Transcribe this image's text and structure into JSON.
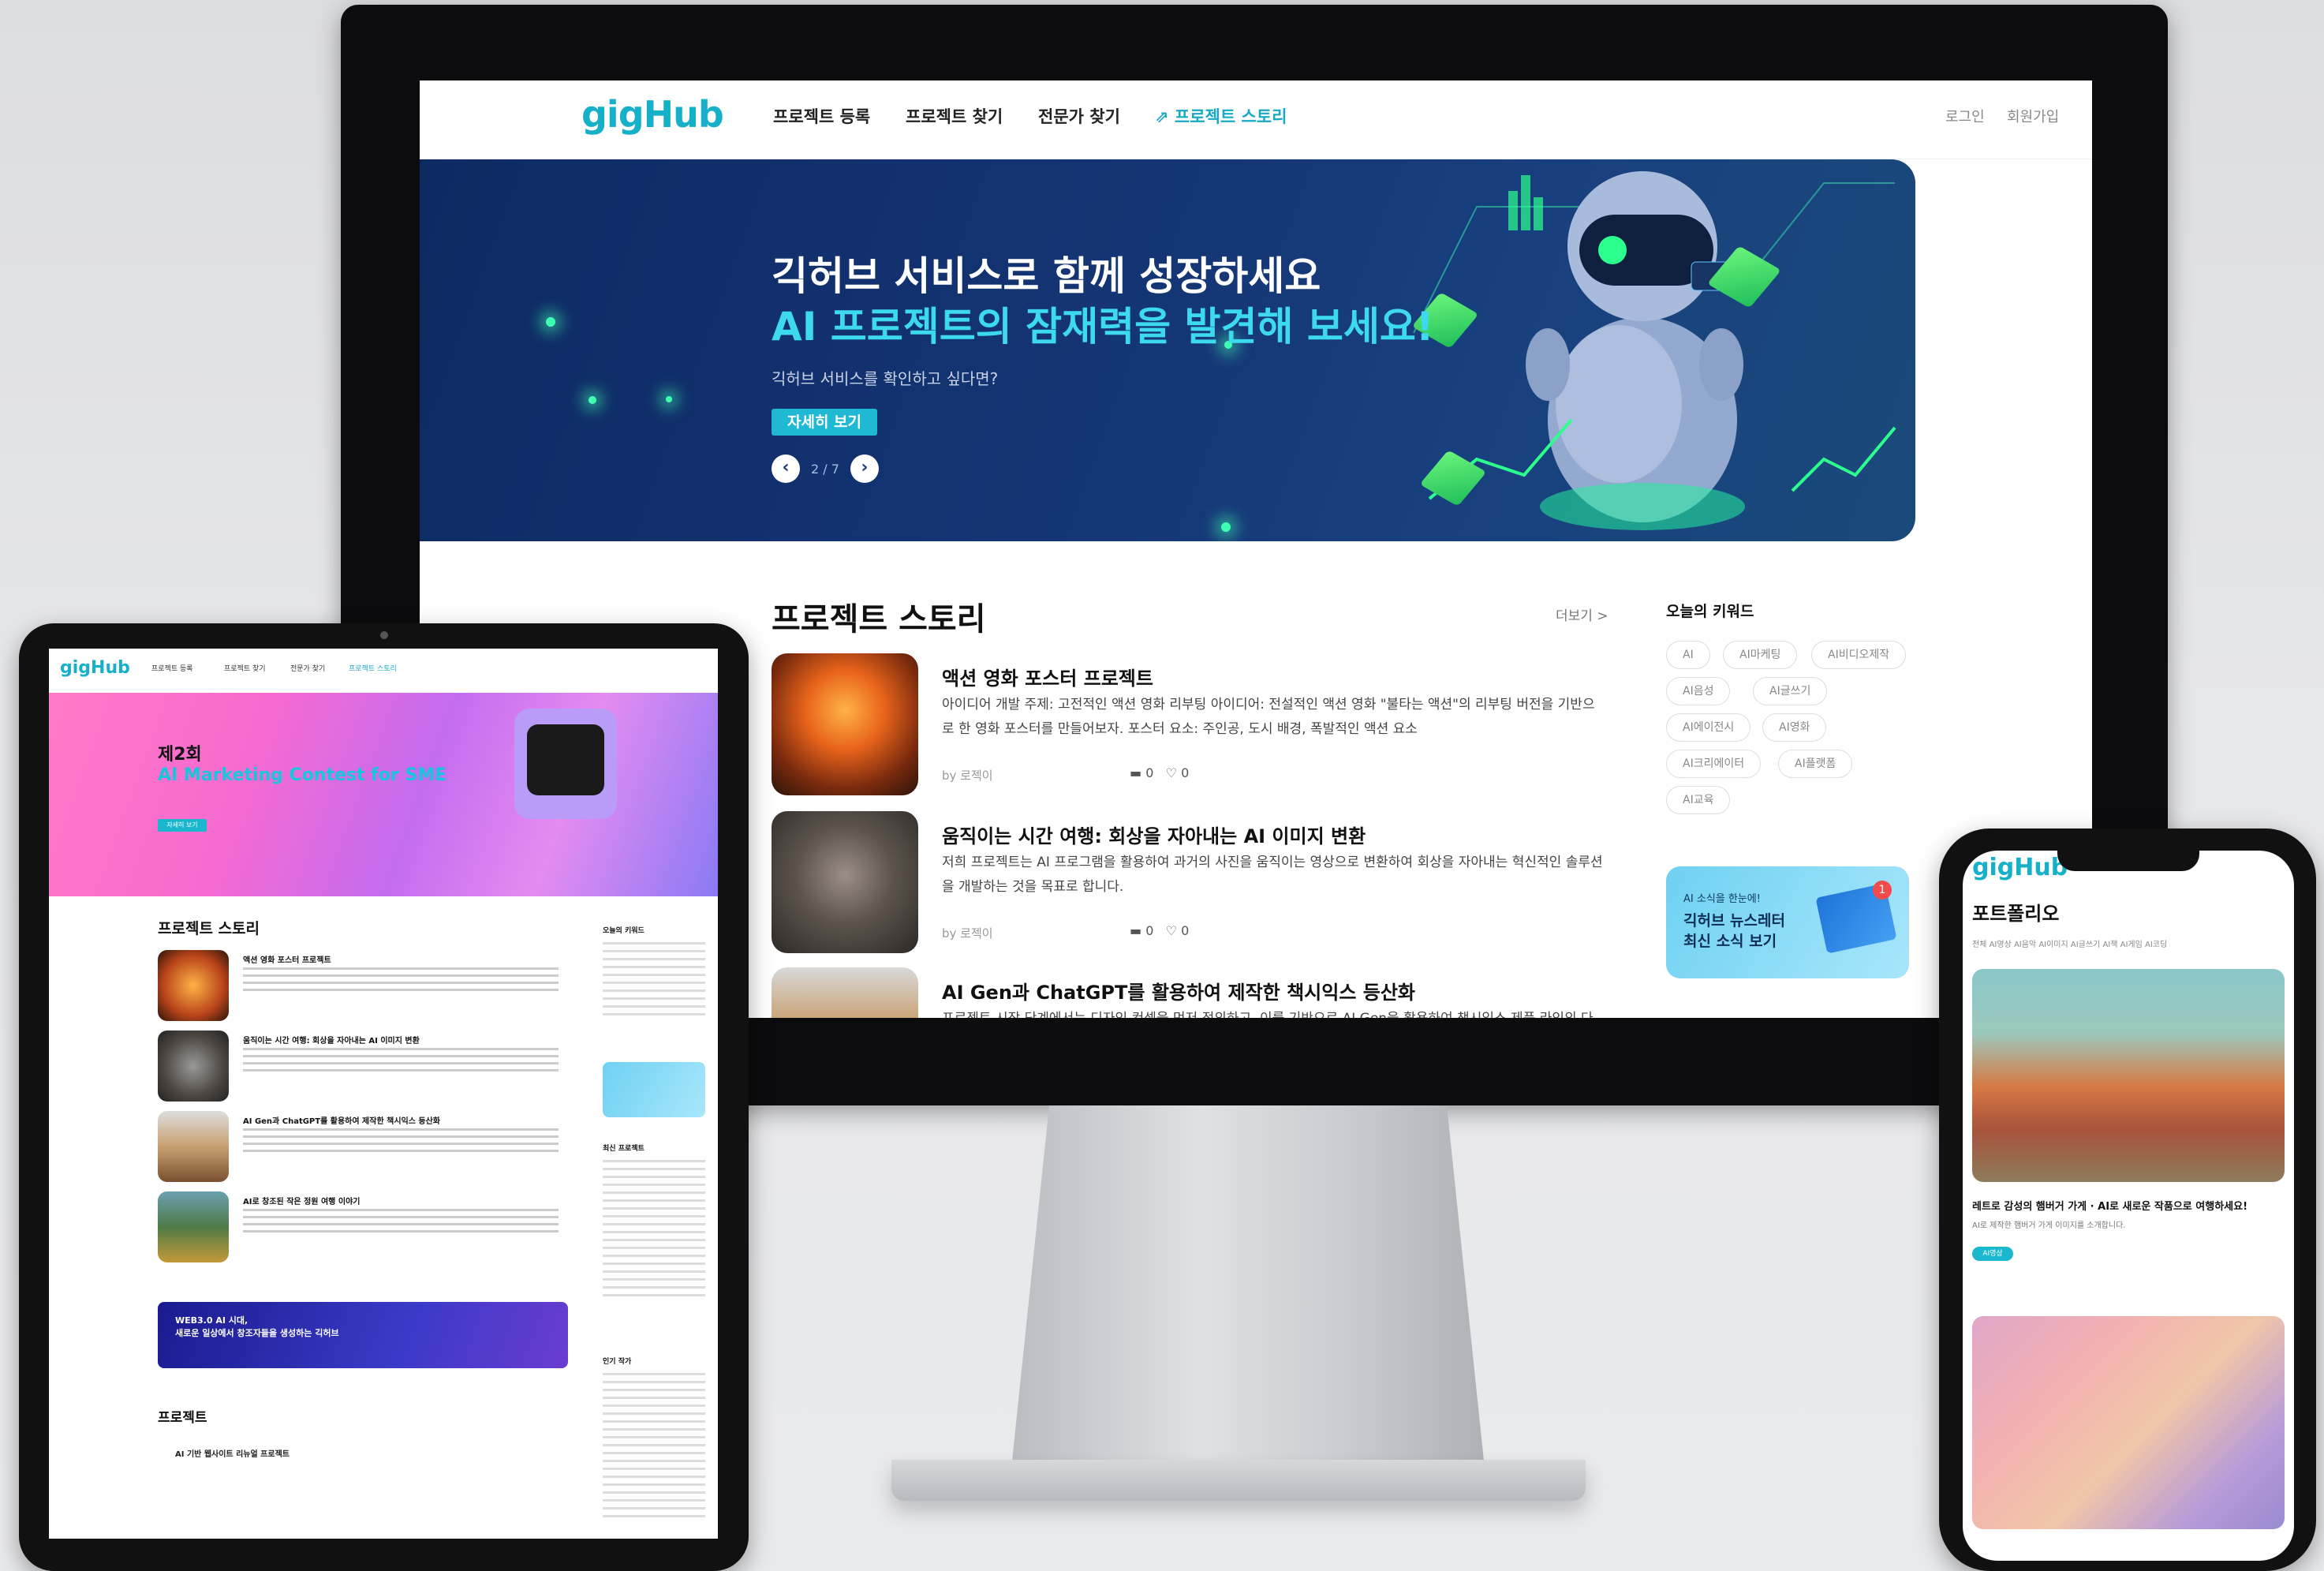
{
  "desktop": {
    "logo": "gigHub",
    "nav": [
      "프로젝트 등록",
      "프로젝트 찾기",
      "전문가 찾기",
      "프로젝트 스토리"
    ],
    "nav_right": [
      "로그인",
      "회원가입"
    ],
    "hero": {
      "line1": "긱허브 서비스로 함께 성장하세요",
      "line2": "AI 프로젝트의 잠재력을 발견해 보세요!",
      "sub": "긱허브 서비스를 확인하고 싶다면?",
      "button": "자세히 보기",
      "pager": "2 / 7"
    },
    "section_title": "프로젝트 스토리",
    "more": "더보기 >",
    "posts": [
      {
        "title": "액션 영화 포스터 프로젝트",
        "desc": "아이디어 개발 주제: 고전적인 액션 영화 리부팅 아이디어: 전설적인 액션 영화 \"불타는 액션\"의 리부팅 버전을 기반으로 한 영화 포스터를 만들어보자. 포스터 요소: 주인공, 도시 배경, 폭발적인 액션 요소",
        "author": "by 로젝이",
        "comments": "0",
        "likes": "0"
      },
      {
        "title": "움직이는 시간 여행: 회상을 자아내는 AI 이미지 변환",
        "desc": "저희 프로젝트는 AI 프로그램을 활용하여 과거의 사진을 움직이는 영상으로 변환하여 회상을 자아내는 혁신적인 솔루션을 개발하는 것을 목표로 합니다.",
        "author": "by 로젝이",
        "comments": "0",
        "likes": "0"
      },
      {
        "title": "AI Gen과 ChatGPT를 활용하여 제작한 책시익스 등산화",
        "desc": "프로젝트 시작 단계에서는 디자인 컨셉을 먼저 정의하고, 이를 기반으로 AI Gen을 활용하여 책시익스 제품 라인의 다양"
      }
    ],
    "keywords_title": "오늘의 키워드",
    "keywords": [
      "AI",
      "AI마케팅",
      "AI비디오제작",
      "AI음성",
      "AI글쓰기",
      "AI에이전시",
      "AI영화",
      "AI크리에이터",
      "AI플랫폼",
      "AI교육"
    ],
    "newsletter": {
      "small": "AI 소식을 한눈에!",
      "big1": "긱허브 뉴스레터",
      "big2": "최신 소식 보기",
      "badge": "1"
    }
  },
  "tablet": {
    "logo": "gigHub",
    "nav": [
      "프로젝트 등록",
      "프로젝트 찾기",
      "전문가 찾기",
      "프로젝트 스토리"
    ],
    "hero": {
      "line1": "제2회",
      "line2": "AI Marketing Contest for SME",
      "button": "자세히 보기"
    },
    "section_title": "프로젝트 스토리",
    "posts": [
      "액션 영화 포스터 프로젝트",
      "움직이는 시간 여행: 회상을 자아내는 AI 이미지 변환",
      "AI Gen과 ChatGPT를 활용하여 제작한 책시익스 등산화",
      "AI로 창조된 작은 정원 여행 이야기"
    ],
    "side_titles": [
      "오늘의 키워드",
      "최신 프로젝트",
      "인기 작가"
    ],
    "banner": {
      "line1": "WEB3.0 AI 시대,",
      "line2": "새로운 일상에서 창조자들을 생성하는 긱허브"
    },
    "projects_title": "프로젝트",
    "project_row": "AI 기반 웹사이트 리뉴얼 프로젝트"
  },
  "phone": {
    "logo": "gigHub",
    "title": "포트폴리오",
    "tabs": "전체  AI영상  AI음악  AI이미지  AI글쓰기  AI책  AI게임  AI코딩",
    "card1_title": "레트로 감성의 햄버거 가게 · AI로 새로운 작품으로 여행하세요!",
    "card1_desc": "AI로 제작한 햄버거 가게 이미지를 소개합니다.",
    "card1_tag": "AI영상"
  },
  "colors": {
    "brand": "#17b0c9",
    "hero_bg": "#143473",
    "hero_accent": "#3cd9ef"
  }
}
